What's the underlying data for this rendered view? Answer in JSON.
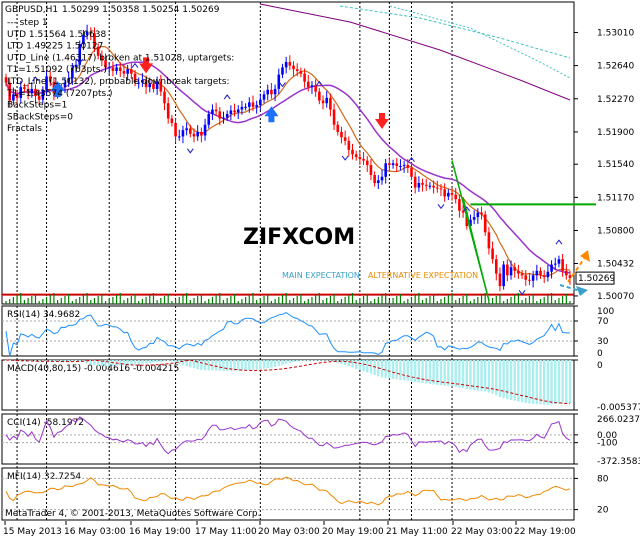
{
  "chart_data": {
    "type": "line",
    "title": "GBPUSD,H1",
    "ohlc_header": "1.50299 1.50358 1.50254 1.50269",
    "last_price": "1.50269",
    "price_ticks": [
      "1.53010",
      "1.52640",
      "1.52270",
      "1.51900",
      "1.51540",
      "1.51170",
      "1.50800",
      "1.50432",
      "1.50070"
    ],
    "price_tick_values": [
      1.5301,
      1.5264,
      1.5227,
      1.519,
      1.5154,
      1.5117,
      1.508,
      1.50432,
      1.5007
    ],
    "price_ylim": [
      1.4998,
      1.5335
    ],
    "time_labels": [
      "15 May 2013",
      "16 May 03:00",
      "16 May 19:00",
      "17 May 11:00",
      "20 May 03:00",
      "20 May 19:00",
      "21 May 11:00",
      "22 May 03:00",
      "22 May 19:00"
    ],
    "vertical_separators": [
      3,
      11,
      28,
      46,
      69,
      96,
      104,
      110,
      121
    ],
    "main_panel_text": [
      "--- step 1",
      "UTD 1.51564 1.50638",
      "LTD 1.49225 1.50127",
      "UTD_Line (1.46317) broken at 1.51028, uptargets:",
      "T1=1.51092 (763pts.)",
      "LTD_Line (1.50132), probable downbreak targets:",
      "T1=1.43574 (7207pts.)",
      "BackSteps=1",
      "SBackSteps=0",
      "Fractals"
    ],
    "watermark": "ZIFXCOM",
    "expectation_main": "MAIN EXPECTATION",
    "expectation_alt": "ALTERNATIVE EXPECTATION",
    "close": [
      1.5245,
      1.5225,
      1.5232,
      1.5228,
      1.524,
      1.5238,
      1.5233,
      1.5238,
      1.523,
      1.5226,
      1.5237,
      1.5252,
      1.5246,
      1.5233,
      1.5238,
      1.524,
      1.5245,
      1.525,
      1.5262,
      1.5265,
      1.5288,
      1.5298,
      1.5302,
      1.53,
      1.5285,
      1.5275,
      1.527,
      1.5262,
      1.5262,
      1.5258,
      1.5262,
      1.5258,
      1.5255,
      1.526,
      1.5255,
      1.5245,
      1.5245,
      1.5248,
      1.524,
      1.5244,
      1.5238,
      1.5246,
      1.5235,
      1.5222,
      1.5205,
      1.52,
      1.5185,
      1.5185,
      1.5192,
      1.5194,
      1.5188,
      1.5185,
      1.519,
      1.5186,
      1.5198,
      1.521,
      1.5215,
      1.5213,
      1.5205,
      1.5206,
      1.521,
      1.5214,
      1.5212,
      1.5215,
      1.5218,
      1.5218,
      1.5223,
      1.5218,
      1.522,
      1.5226,
      1.5232,
      1.5237,
      1.5232,
      1.5238,
      1.5254,
      1.5262,
      1.5268,
      1.5264,
      1.526,
      1.5258,
      1.5255,
      1.5246,
      1.524,
      1.5242,
      1.5235,
      1.5225,
      1.5222,
      1.5228,
      1.5215,
      1.5198,
      1.519,
      1.5184,
      1.518,
      1.517,
      1.5165,
      1.5162,
      1.516,
      1.5158,
      1.5153,
      1.5142,
      1.5133,
      1.5136,
      1.514,
      1.5155,
      1.5153,
      1.5155,
      1.5152,
      1.5152,
      1.5153,
      1.515,
      1.514,
      1.5128,
      1.5133,
      1.5131,
      1.513,
      1.513,
      1.5128,
      1.5127,
      1.5126,
      1.5118,
      1.5122,
      1.512,
      1.5115,
      1.5102,
      1.51,
      1.5085,
      1.5092,
      1.5095,
      1.51,
      1.5098,
      1.5078,
      1.506,
      1.5048,
      1.5032,
      1.5018,
      1.5042,
      1.503,
      1.5039,
      1.5035,
      1.5032,
      1.503,
      1.5025,
      1.5024,
      1.503,
      1.5035,
      1.503,
      1.5028,
      1.5034,
      1.5042,
      1.5043,
      1.5048,
      1.5035,
      1.503,
      1.5027
    ],
    "indicators": [
      {
        "name": "RSI(14)",
        "value_text": "34.9682",
        "ticks": [
          "100",
          "70",
          "30",
          "0"
        ],
        "ylim": [
          0,
          100
        ]
      },
      {
        "name": "MACD(40,80,15)",
        "value_text": "-0.004616 -0.004215",
        "ticks": [
          "0",
          "-0.005377"
        ],
        "ylim": [
          -0.005377,
          0
        ]
      },
      {
        "name": "CCI(14)",
        "value_text": "-58.1972",
        "ticks": [
          "266.0237",
          "0.00",
          "-100",
          "-372.3583"
        ],
        "ylim": [
          -372.3583,
          266.0237
        ]
      },
      {
        "name": "MFI(14)",
        "value_text": "32.7254",
        "ticks": [
          "80",
          "20"
        ],
        "ylim": [
          0,
          100
        ]
      }
    ],
    "copyright": "MetaTrader 4, © 2001-2013, MetaQuotes Software Corp.",
    "colors": {
      "bull": "#0000ff",
      "bear": "#ff0000",
      "ma_tan": "#d2691e",
      "ma_purple": "#9933cc",
      "ma_cyan": "#40c0c0",
      "ma_dark": "#800080",
      "level_green": "#00aa00",
      "rsi": "#1e90ff",
      "macd_hist": "#aaeeee",
      "macd_signal": "#cc0000",
      "cci": "#9933cc",
      "mfi": "#ee8800",
      "volume": "#008000"
    }
  }
}
